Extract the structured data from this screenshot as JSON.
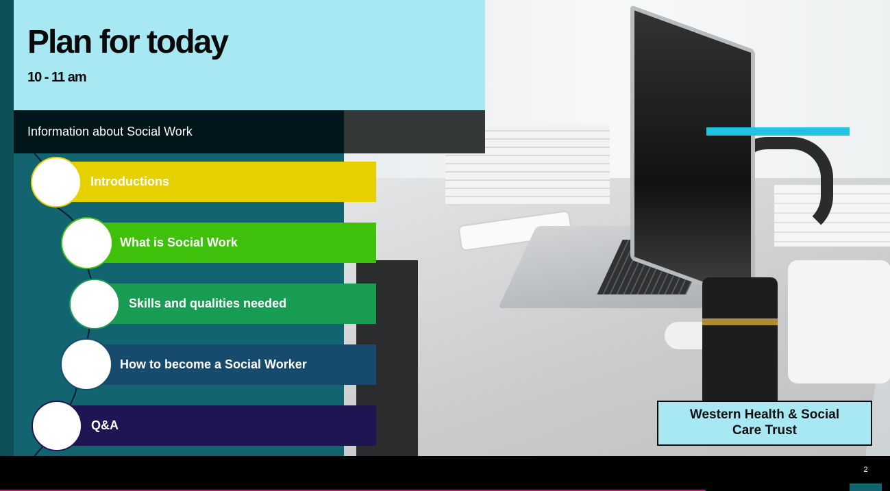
{
  "header": {
    "title": "Plan for today",
    "time": "10 - 11 am"
  },
  "info_bar": {
    "text": "Information about Social Work"
  },
  "agenda": {
    "items": [
      {
        "label": "Introductions",
        "color": "#e6d000"
      },
      {
        "label": "What is Social Work",
        "color": "#3fc10b"
      },
      {
        "label": "Skills and qualities needed",
        "color": "#189c52"
      },
      {
        "label": "How to become a Social Worker",
        "color": "#164b6d"
      },
      {
        "label": "Q&A",
        "color": "#1f1552"
      }
    ]
  },
  "organisation": {
    "line1": "Western Health & Social",
    "line2": "Care Trust"
  },
  "footer": {
    "page_number": "2"
  },
  "colors": {
    "header_bg": "#a8e8f3",
    "panel_bg": "#126470",
    "accent": "#20c3e0",
    "footer_accent": "#d1156f"
  }
}
